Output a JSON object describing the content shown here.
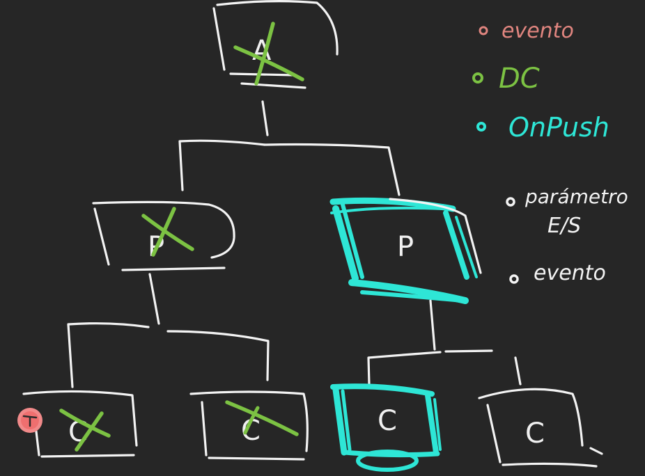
{
  "colors": {
    "background": "#262626",
    "chalk": "#f3f3f3",
    "default_cd": "#e0857f",
    "default_cd_strong": "#f18a8a",
    "dc": "#7cc243",
    "onpush": "#2ee6d6"
  },
  "legend_top": {
    "items": [
      {
        "label": "evento",
        "color": "#e0857f"
      },
      {
        "label": "DC",
        "color": "#7cc243"
      },
      {
        "label": "OnPush",
        "color": "#2ee6d6"
      }
    ]
  },
  "legend_bottom": {
    "items": [
      {
        "label": "parámetro",
        "label_line2": "E/S"
      },
      {
        "label": "evento"
      }
    ]
  },
  "tree": {
    "root": {
      "letter": "A"
    },
    "left_parent": {
      "letter": "P"
    },
    "right_parent": {
      "letter": "P"
    },
    "children": [
      {
        "letter": "C"
      },
      {
        "letter": "C"
      },
      {
        "letter": "C"
      },
      {
        "letter": "C"
      }
    ]
  }
}
